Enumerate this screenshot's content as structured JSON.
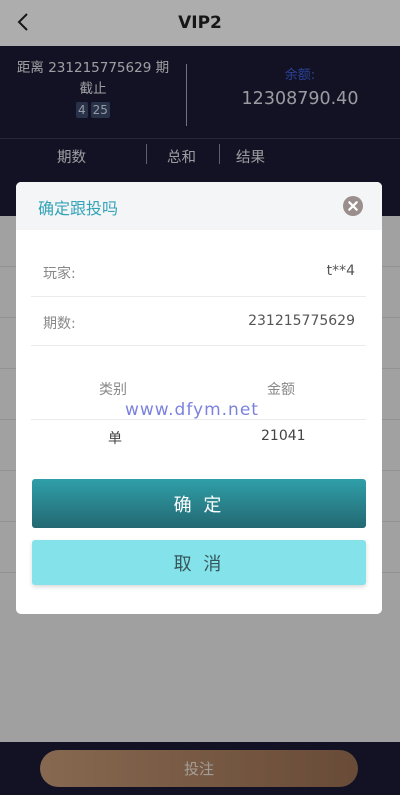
{
  "header": {
    "title": "VIP2"
  },
  "info": {
    "period_line": "距离 231215775629 期",
    "deadline": "截止",
    "timer": [
      "4",
      "25"
    ],
    "balance_label": "余额:",
    "balance_value": "12308790.40"
  },
  "table": {
    "columns": [
      "期数",
      "总和",
      "结果"
    ]
  },
  "modal": {
    "title": "确定跟投吗",
    "player_label": "玩家:",
    "player_value": "t**4",
    "period_label": "期数:",
    "period_value": "231215775629",
    "col_type": "类别",
    "col_amount": "金额",
    "row_type": "单",
    "row_amount": "21041",
    "confirm": "确 定",
    "cancel": "取 消"
  },
  "footer": {
    "bet": "投注"
  },
  "watermark": "www.dfym.net"
}
